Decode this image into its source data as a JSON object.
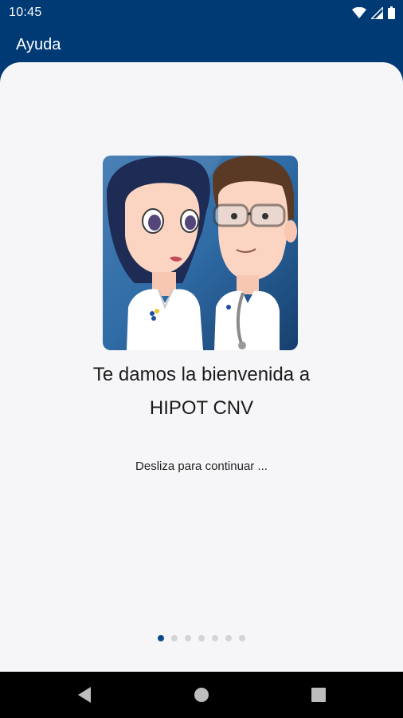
{
  "status_bar": {
    "time": "10:45",
    "icons": [
      "wifi-icon",
      "cell-signal-icon",
      "battery-icon"
    ]
  },
  "app_bar": {
    "title": "Ayuda"
  },
  "onboarding": {
    "image": "nurse-and-doctor-illustration",
    "title_line1": "Te damos la bienvenida a",
    "title_line2": "HIPOT CNV",
    "hint": "Desliza para continuar ...",
    "page_count": 7,
    "current_page": 1
  },
  "nav_bar": {
    "icons": [
      "back-icon",
      "home-icon",
      "recents-icon"
    ]
  },
  "colors": {
    "header": "#003a75",
    "card_bg": "#f6f6f8",
    "dot_active": "#0b4d8c",
    "dot_inactive": "#d4d4d8"
  }
}
